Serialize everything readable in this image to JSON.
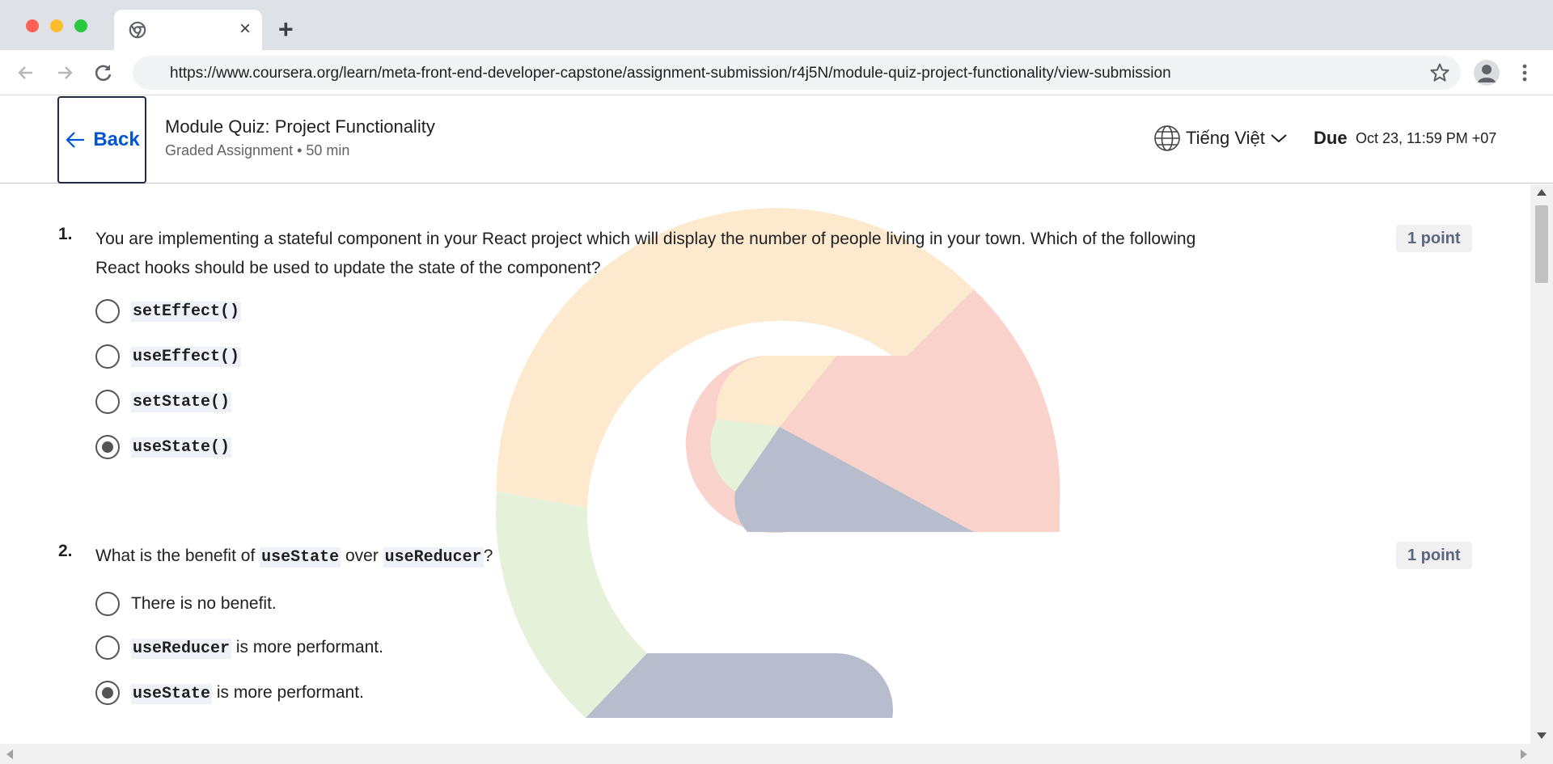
{
  "browser": {
    "tab_title": "",
    "tab_close": "×",
    "new_tab": "+",
    "url": "https://www.coursera.org/learn/meta-front-end-developer-capstone/assignment-submission/r4j5N/module-quiz-project-functionality/view-submission"
  },
  "header": {
    "back_label": "Back",
    "title": "Module Quiz: Project Functionality",
    "subtitle": "Graded Assignment • 50 min",
    "language": "Tiếng Việt",
    "due_label": "Due",
    "due_date": "Oct 23, 11:59 PM +07"
  },
  "questions": [
    {
      "number": "1.",
      "text_line1": "You are implementing a stateful component in your React project which will display the number of people living in your town. Which of the following",
      "text_line2": "React hooks should be used to update the state of the component?",
      "points": "1 point",
      "options": [
        {
          "code": "setEffect()",
          "checked": false
        },
        {
          "code": "useEffect()",
          "checked": false
        },
        {
          "code": "setState()",
          "checked": false
        },
        {
          "code": "useState()",
          "checked": true
        }
      ]
    },
    {
      "number": "2.",
      "text_pre": "What is the benefit of ",
      "text_code1": "useState",
      "text_mid": " over ",
      "text_code2": "useReducer",
      "text_post": "?",
      "points": "1 point",
      "options": [
        {
          "text": "There is no benefit.",
          "checked": false
        },
        {
          "code": "useReducer",
          "text": " is more performant.",
          "checked": false
        },
        {
          "code": "useState",
          "text": " is more performant.",
          "checked": true
        }
      ]
    }
  ],
  "colors": {
    "accent": "#0056d2",
    "watermark_orange": "#fbbf6d",
    "watermark_red": "#ee7966",
    "watermark_green": "#b5d68d",
    "watermark_navy": "#2a3b6b"
  }
}
